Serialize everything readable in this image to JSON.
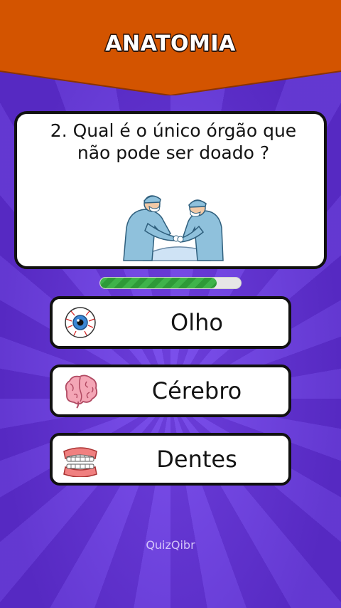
{
  "header": {
    "title": "ANATOMIA",
    "color": "#d35400"
  },
  "question": {
    "text": "2. Qual é o único órgão que não pode ser doado ?"
  },
  "progress": {
    "value": 0.83,
    "color": "#3fb34a"
  },
  "answers": [
    {
      "label": "Olho",
      "icon": "eye-icon"
    },
    {
      "label": "Cérebro",
      "icon": "brain-icon"
    },
    {
      "label": "Dentes",
      "icon": "teeth-icon"
    }
  ],
  "brand": {
    "name": "QuizQibr"
  },
  "colors": {
    "background": "#6a3ad8",
    "card": "#ffffff",
    "border": "#111111"
  }
}
